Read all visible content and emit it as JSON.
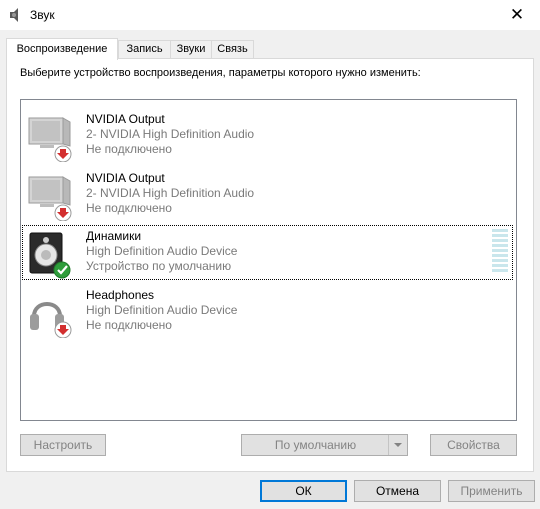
{
  "window": {
    "title": "Звук",
    "close_glyph": "✕"
  },
  "tabs": [
    {
      "label": "Воспроизведение",
      "active": true
    },
    {
      "label": "Запись",
      "active": false
    },
    {
      "label": "Звуки",
      "active": false
    },
    {
      "label": "Связь",
      "active": false
    }
  ],
  "instruction": "Выберите устройство воспроизведения, параметры которого нужно изменить:",
  "devices": [
    {
      "name": "NVIDIA Output",
      "description": "2- NVIDIA High Definition Audio",
      "status": "Не подключено",
      "icon": "monitor-icon",
      "badge": "disconnected-arrow-icon"
    },
    {
      "name": "NVIDIA Output",
      "description": "2- NVIDIA High Definition Audio",
      "status": "Не подключено",
      "icon": "monitor-icon",
      "badge": "disconnected-arrow-icon"
    },
    {
      "name": "Динамики",
      "description": "High Definition Audio Device",
      "status": "Устройство по умолчанию",
      "icon": "speaker-icon",
      "badge": "default-check-icon",
      "selected": true,
      "level": 0
    },
    {
      "name": "Headphones",
      "description": "High Definition Audio Device",
      "status": "Не подключено",
      "icon": "headphones-icon",
      "badge": "disconnected-arrow-icon"
    }
  ],
  "panel_buttons": {
    "configure": "Настроить",
    "set_default": "По умолчанию",
    "properties": "Свойства"
  },
  "dialog_buttons": {
    "ok": "ОК",
    "cancel": "Отмена",
    "apply": "Применить"
  },
  "colors": {
    "accent": "#0078d7",
    "badge_red": "#d32f2f",
    "badge_green": "#2e9d3b",
    "meter": "#c9e6ec"
  }
}
